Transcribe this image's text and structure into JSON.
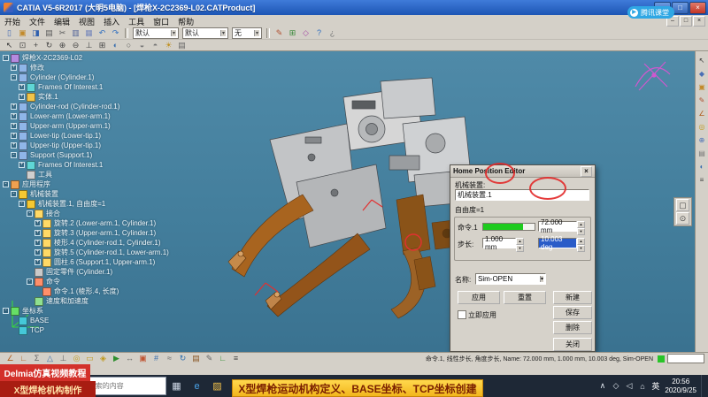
{
  "window": {
    "title": "CATIA V5-6R2017 (大明5电脑) - [焊枪X-2C2369-L02.CATProduct]",
    "minimize": "–",
    "maximize": "□",
    "close": "×"
  },
  "watermark": {
    "label": "腾讯课堂",
    "logo_glyph": "▶"
  },
  "menu": {
    "items": [
      "开始",
      "文件",
      "编辑",
      "视图",
      "插入",
      "工具",
      "窗口",
      "帮助"
    ]
  },
  "toolbars": {
    "combo_values": [
      "默认",
      "默认",
      "无"
    ],
    "row1_icons_a": [
      {
        "name": "new-file-icon",
        "glyph": "▯",
        "color": "#4a6fb5"
      },
      {
        "name": "open-folder-icon",
        "glyph": "▣",
        "color": "#c28a2a"
      },
      {
        "name": "save-icon",
        "glyph": "◨",
        "color": "#2f5fae"
      },
      {
        "name": "print-icon",
        "glyph": "▤",
        "color": "#5a5a5a"
      },
      {
        "name": "cut-icon",
        "glyph": "✂",
        "color": "#555555"
      },
      {
        "name": "copy-icon",
        "glyph": "▥",
        "color": "#556699"
      },
      {
        "name": "paste-icon",
        "glyph": "▦",
        "color": "#7788bb"
      },
      {
        "name": "undo-icon",
        "glyph": "↶",
        "color": "#2f6fc0"
      },
      {
        "name": "redo-icon",
        "glyph": "↷",
        "color": "#2f6fc0"
      }
    ],
    "row1_icons_b": [
      {
        "name": "paint-brush-icon",
        "glyph": "✎",
        "color": "#b05030"
      },
      {
        "name": "graph-tree-icon",
        "glyph": "⊞",
        "color": "#3a8a3a"
      },
      {
        "name": "compass-tool-icon",
        "glyph": "◇",
        "color": "#a44aa4"
      },
      {
        "name": "help-icon",
        "glyph": "?",
        "color": "#2f6fc0"
      },
      {
        "name": "whats-this-icon",
        "glyph": "¿",
        "color": "#777777"
      }
    ],
    "row2_icons": [
      {
        "name": "select-arrow-icon",
        "glyph": "↖",
        "color": "#333333"
      },
      {
        "name": "fit-all-icon",
        "glyph": "⊡",
        "color": "#444444"
      },
      {
        "name": "pan-icon",
        "glyph": "+",
        "color": "#444444"
      },
      {
        "name": "rotate-view-icon",
        "glyph": "↻",
        "color": "#444444"
      },
      {
        "name": "zoom-in-icon",
        "glyph": "⊕",
        "color": "#444444"
      },
      {
        "name": "zoom-out-icon",
        "glyph": "⊖",
        "color": "#444444"
      },
      {
        "name": "normal-view-icon",
        "glyph": "⊥",
        "color": "#444444"
      },
      {
        "name": "multi-view-icon",
        "glyph": "⊞",
        "color": "#444444"
      },
      {
        "name": "shaded-view-icon",
        "glyph": "◐",
        "color": "#3a6fae"
      },
      {
        "name": "wireframe-view-icon",
        "glyph": "○",
        "color": "#555555"
      },
      {
        "name": "hide-show-icon",
        "glyph": "◒",
        "color": "#777777"
      },
      {
        "name": "swap-visible-space-icon",
        "glyph": "◓",
        "color": "#777777"
      },
      {
        "name": "sun-light-icon",
        "glyph": "☀",
        "color": "#c09020"
      },
      {
        "name": "layers-icon",
        "glyph": "▤",
        "color": "#666666"
      }
    ],
    "bottom_icons": [
      {
        "name": "measure-between-icon",
        "glyph": "∠",
        "color": "#b06020"
      },
      {
        "name": "measure-item-icon",
        "glyph": "∟",
        "color": "#b06020"
      },
      {
        "name": "measure-inertia-icon",
        "glyph": "Σ",
        "color": "#666666"
      },
      {
        "name": "constraint-icon",
        "glyph": "△",
        "color": "#3a6fae"
      },
      {
        "name": "fix-part-icon",
        "glyph": "⊥",
        "color": "#666666"
      },
      {
        "name": "revolute-joint-icon",
        "glyph": "◎",
        "color": "#c09a20"
      },
      {
        "name": "prismatic-joint-icon",
        "glyph": "▭",
        "color": "#c09a20"
      },
      {
        "name": "mechanism-icon",
        "glyph": "◈",
        "color": "#c09a20"
      },
      {
        "name": "simulation-play-icon",
        "glyph": "▶",
        "color": "#2f8f2f"
      },
      {
        "name": "dof-icon",
        "glyph": "↔",
        "color": "#666666"
      },
      {
        "name": "command-icon",
        "glyph": "▣",
        "color": "#c05533"
      },
      {
        "name": "frames-icon",
        "glyph": "#",
        "color": "#3a6fae"
      },
      {
        "name": "snap-icon",
        "glyph": "≈",
        "color": "#666666"
      },
      {
        "name": "update-icon",
        "glyph": "↻",
        "color": "#2f6fae"
      },
      {
        "name": "catalog-icon",
        "glyph": "▤",
        "color": "#885522"
      },
      {
        "name": "annotation-icon",
        "glyph": "✎",
        "color": "#666666"
      },
      {
        "name": "axis-system-icon",
        "glyph": "∟",
        "color": "#2f8f2f"
      },
      {
        "name": "options-icon",
        "glyph": "≡",
        "color": "#444444"
      }
    ],
    "right_icons": [
      {
        "name": "select-tool-icon",
        "glyph": "↖",
        "color": "#333333"
      },
      {
        "name": "product-structure-icon",
        "glyph": "◆",
        "color": "#4a6fb5"
      },
      {
        "name": "part-design-icon",
        "glyph": "▣",
        "color": "#c28a2a"
      },
      {
        "name": "sketcher-icon",
        "glyph": "✎",
        "color": "#b05030"
      },
      {
        "name": "measure-tool-icon",
        "glyph": "∠",
        "color": "#b06020"
      },
      {
        "name": "joint-tool-icon",
        "glyph": "◎",
        "color": "#c09a20"
      },
      {
        "name": "assemble-icon",
        "glyph": "⊕",
        "color": "#4a6fb5"
      },
      {
        "name": "material-icon",
        "glyph": "▤",
        "color": "#777777"
      },
      {
        "name": "render-style-icon",
        "glyph": "◐",
        "color": "#3a6fae"
      },
      {
        "name": "settings-icon",
        "glyph": "≡",
        "color": "#444444"
      }
    ],
    "palette_icons": [
      {
        "name": "viewpoint-icon",
        "glyph": "▢",
        "color": "#444444"
      },
      {
        "name": "magnifier-icon",
        "glyph": "⊙",
        "color": "#444444"
      }
    ]
  },
  "tree": {
    "icon_colors": {
      "product": "#b48ae0",
      "part": "#8fb6e8",
      "frame": "#5fd6d6",
      "body": "#f0c44a",
      "tool": "#cfcfcf",
      "app": "#f0a050",
      "mech": "#f5c832",
      "joint": "#ffd966",
      "fix": "#c9c9c9",
      "cmd": "#ff8f6a",
      "speed": "#8fe08f",
      "axis": "#66e066",
      "plane": "#45c8d8"
    },
    "rows": [
      {
        "i": 0,
        "e": "-",
        "t": "product",
        "l": "焊枪X-2C2369-L02"
      },
      {
        "i": 1,
        "e": "+",
        "t": "part",
        "l": "修改"
      },
      {
        "i": 1,
        "e": "-",
        "t": "part",
        "l": "Cylinder (Cylinder.1)"
      },
      {
        "i": 2,
        "e": "+",
        "t": "frame",
        "l": "Frames Of Interest.1"
      },
      {
        "i": 2,
        "e": "+",
        "t": "body",
        "l": "实体.1"
      },
      {
        "i": 1,
        "e": "+",
        "t": "part",
        "l": "Cylinder-rod (Cylinder-rod.1)"
      },
      {
        "i": 1,
        "e": "+",
        "t": "part",
        "l": "Lower-arm (Lower-arm.1)"
      },
      {
        "i": 1,
        "e": "+",
        "t": "part",
        "l": "Upper-arm (Upper-arm.1)"
      },
      {
        "i": 1,
        "e": "+",
        "t": "part",
        "l": "Lower-tip (Lower-tip.1)"
      },
      {
        "i": 1,
        "e": "+",
        "t": "part",
        "l": "Upper-tip (Upper-tip.1)"
      },
      {
        "i": 1,
        "e": "-",
        "t": "part",
        "l": "Support (Support.1)"
      },
      {
        "i": 2,
        "e": "+",
        "t": "frame",
        "l": "Frames Of Interest.1"
      },
      {
        "i": 2,
        "e": "",
        "t": "tool",
        "l": "工具"
      },
      {
        "i": 0,
        "e": "-",
        "t": "app",
        "l": "应用程序"
      },
      {
        "i": 1,
        "e": "-",
        "t": "mech",
        "l": "机械装置"
      },
      {
        "i": 2,
        "e": "-",
        "t": "mech",
        "l": "机械装置.1, 自由度=1"
      },
      {
        "i": 3,
        "e": "-",
        "t": "joint",
        "l": "接合"
      },
      {
        "i": 4,
        "e": "+",
        "t": "joint",
        "l": "旋转.2 (Lower-arm.1, Cylinder.1)"
      },
      {
        "i": 4,
        "e": "+",
        "t": "joint",
        "l": "旋转.3 (Upper-arm.1, Cylinder.1)"
      },
      {
        "i": 4,
        "e": "+",
        "t": "joint",
        "l": "棱形.4 (Cylinder-rod.1, Cylinder.1)"
      },
      {
        "i": 4,
        "e": "+",
        "t": "joint",
        "l": "旋转.5 (Cylinder-rod.1, Lower-arm.1)"
      },
      {
        "i": 4,
        "e": "+",
        "t": "joint",
        "l": "圆柱.6 (Support.1, Upper-arm.1)"
      },
      {
        "i": 3,
        "e": "",
        "t": "fix",
        "l": "固定零件 (Cylinder.1)"
      },
      {
        "i": 3,
        "e": "-",
        "t": "cmd",
        "l": "命令"
      },
      {
        "i": 4,
        "e": "",
        "t": "cmd",
        "l": "命令.1 (棱形.4, 长度)"
      },
      {
        "i": 3,
        "e": "",
        "t": "speed",
        "l": "速度和加速度"
      },
      {
        "i": 0,
        "e": "-",
        "t": "axis",
        "l": "坐标系"
      },
      {
        "i": 1,
        "e": "",
        "t": "plane",
        "l": "BASE"
      },
      {
        "i": 1,
        "e": "",
        "t": "plane",
        "l": "TCP"
      }
    ]
  },
  "dialog": {
    "title": "Home Position Editor",
    "close_glyph": "×",
    "mechanism_label": "机械装置:",
    "mechanism_value": "机械装置.1",
    "dof_text": "自由度=1",
    "command_label": "命令.1",
    "command_value": "72.000 mm",
    "step_label": "步长:",
    "linear_step_value": "1.000 mm",
    "angular_step_value": "10.003 deg",
    "apply_button": "应用",
    "reset_button": "重置",
    "name_label": "名称:",
    "name_value": "Sim-OPEN",
    "new_button": "新建",
    "save_button": "保存",
    "delete_button": "删除",
    "auto_apply_label": "立即应用",
    "close_button": "关闭",
    "slider_percent": 78
  },
  "status": {
    "right_text": "命令.1, 线性步长, 角度步长, Name: 72.000 mm, 1.000 mm, 10.003 deg, Sim-OPEN"
  },
  "taskbar": {
    "start_glyph": "⊞",
    "search_icon_glyph": "⊙",
    "search_placeholder": "在这里输入你要搜索的内容",
    "app_icons": [
      {
        "name": "task-view-icon",
        "glyph": "▦",
        "color": "#cfd8e6"
      },
      {
        "name": "edge-browser-icon",
        "glyph": "e",
        "color": "#4aa3e8"
      },
      {
        "name": "file-explorer-icon",
        "glyph": "▨",
        "color": "#f2c14a"
      },
      {
        "name": "browser-icon",
        "glyph": "◉",
        "color": "#e8734a"
      },
      {
        "name": "catia-app-icon",
        "glyph": "◆",
        "color": "#f08030"
      },
      {
        "name": "wechat-icon",
        "glyph": "●",
        "color": "#3fcf6f"
      },
      {
        "name": "media-player-icon",
        "glyph": "▶",
        "color": "#d86aa0"
      },
      {
        "name": "notepad-icon",
        "glyph": "▤",
        "color": "#9fc3ff"
      }
    ],
    "tray_icons": [
      {
        "name": "tray-chevron-icon",
        "glyph": "∧",
        "color": "#dfe6ee"
      },
      {
        "name": "antivirus-icon",
        "glyph": "◇",
        "color": "#dfe6ee"
      },
      {
        "name": "volume-icon",
        "glyph": "◁",
        "color": "#dfe6ee"
      },
      {
        "name": "network-icon",
        "glyph": "⌂",
        "color": "#dfe6ee"
      },
      {
        "name": "ime-indicator",
        "glyph": "英",
        "color": "#ffffff"
      }
    ],
    "time": "20:56",
    "date": "2020/9/25"
  },
  "banners": {
    "line1": "Delmia仿真视频教程",
    "line2": "X型焊枪机构制作",
    "center": "X型焊枪运动机构定义、BASE坐标、TCP坐标创建"
  },
  "colors": {
    "viewport_teal": "#437e9c",
    "slider_green": "#1ecb1e",
    "selection_blue": "#2a5cc8",
    "banner_red": "#d3302a",
    "banner_yellow": "#f2b61c",
    "taskbar_dark": "#1e2836"
  }
}
